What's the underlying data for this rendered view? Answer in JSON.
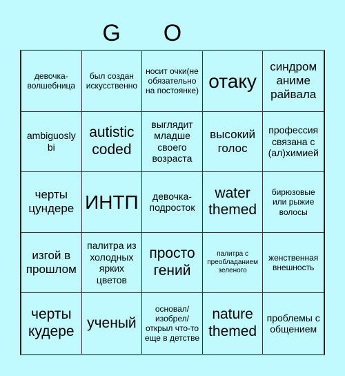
{
  "header": {
    "letters": [
      "",
      "G",
      "O",
      "",
      ""
    ]
  },
  "colors": {
    "background": "#c0fafe",
    "grid_line": "#333333",
    "text": "#000000"
  },
  "board": {
    "rows": [
      [
        {
          "text": "девочка-волшебница",
          "size": "sm"
        },
        {
          "text": "был создан искусственно",
          "size": "sm"
        },
        {
          "text": "носит очки(не обязательно на постоянке)",
          "size": "sm"
        },
        {
          "text": "отаку",
          "size": "xxl"
        },
        {
          "text": "синдром аниме райвала",
          "size": "lg"
        }
      ],
      [
        {
          "text": "ambiguosly bi",
          "size": "md"
        },
        {
          "text": "autistic coded",
          "size": "xl"
        },
        {
          "text": "выглядит младше своего возраста",
          "size": "md"
        },
        {
          "text": "высокий голос",
          "size": "lg"
        },
        {
          "text": "профессия связана с (ал)химией",
          "size": "md"
        }
      ],
      [
        {
          "text": "черты цундере",
          "size": "lg"
        },
        {
          "text": "ИНТП",
          "size": "xxl"
        },
        {
          "text": "девочка-подросток",
          "size": "md"
        },
        {
          "text": "water themed",
          "size": "xl"
        },
        {
          "text": "бирюзовые или рыжие волосы",
          "size": "sm"
        }
      ],
      [
        {
          "text": "изгой в прошлом",
          "size": "lg"
        },
        {
          "text": "палитра из холодных ярких цветов",
          "size": "md"
        },
        {
          "text": "просто гений",
          "size": "xl"
        },
        {
          "text": "палитра с преобладанием зеленого",
          "size": "xs"
        },
        {
          "text": "женственная внешность",
          "size": "sm"
        }
      ],
      [
        {
          "text": "черты кудере",
          "size": "xl"
        },
        {
          "text": "ученый",
          "size": "xl"
        },
        {
          "text": "основал/ изобрел/ открыл что-то еще в детстве",
          "size": "sm"
        },
        {
          "text": "nature themed",
          "size": "xl"
        },
        {
          "text": "проблемы с общением",
          "size": "md"
        }
      ]
    ]
  }
}
